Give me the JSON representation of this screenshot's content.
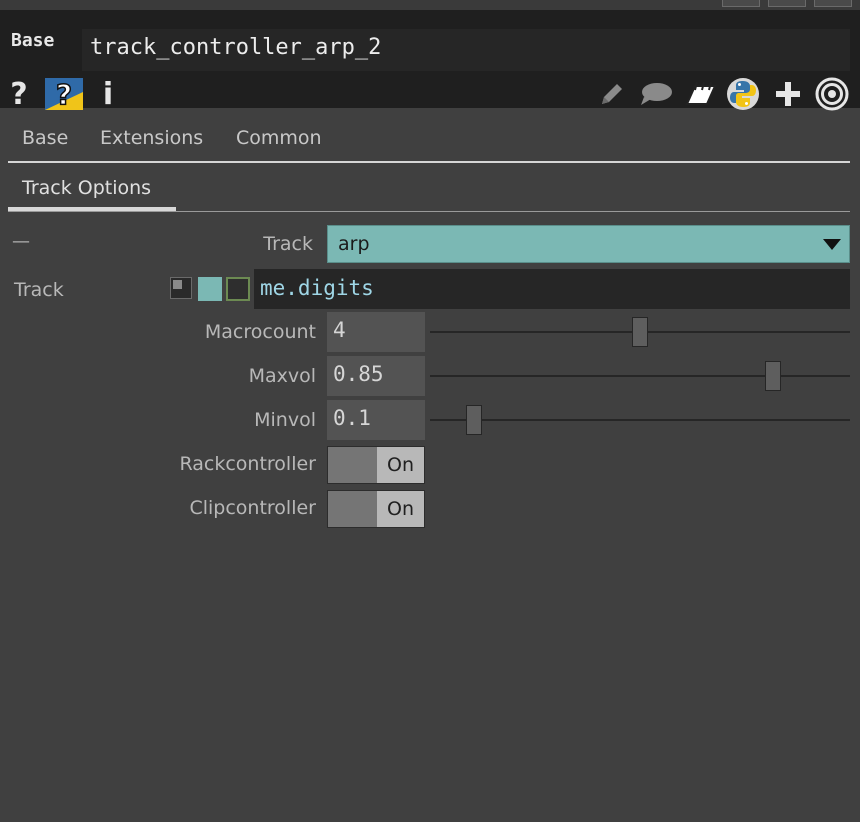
{
  "header": {
    "op_type": "Base",
    "op_name": "track_controller_arp_2"
  },
  "icons": {
    "help": "question-icon",
    "python_help": "python-help-icon",
    "info": "info-icon",
    "edit": "pencil-icon",
    "comment": "comment-icon",
    "docs": "notepad-icon",
    "python": "python-icon",
    "add": "plus-icon",
    "target": "target-icon"
  },
  "tabs": {
    "row1": [
      "Base",
      "Extensions",
      "Common"
    ],
    "row2": [
      "Track Options"
    ]
  },
  "params": {
    "menu_prefix": "—",
    "track_menu_label": "Track",
    "track_menu_value": "arp",
    "track_expr_label": "Track",
    "track_expr_value": "me.digits",
    "macrocount": {
      "label": "Macrocount",
      "value": "4",
      "slider": 0.5
    },
    "maxvol": {
      "label": "Maxvol",
      "value": "0.85",
      "slider": 0.83
    },
    "minvol": {
      "label": "Minvol",
      "value": "0.1",
      "slider": 0.09
    },
    "rackcontroller": {
      "label": "Rackcontroller",
      "state": "On"
    },
    "clipcontroller": {
      "label": "Clipcontroller",
      "state": "On"
    }
  },
  "colors": {
    "menu_bg": "#7bb8b4",
    "expr_text": "#9fd6e6",
    "header_bg": "#1f1f1f",
    "panel_bg": "#404040"
  }
}
